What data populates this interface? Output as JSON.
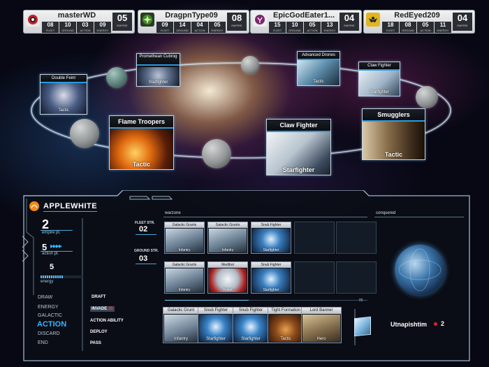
{
  "players": [
    {
      "name": "masterWD",
      "icon": "red-target-emblem",
      "fleet": "08",
      "ground": "10",
      "action": "03",
      "energy": "09",
      "empire": "05",
      "color": "#c8202a"
    },
    {
      "name": "DragpnType09",
      "icon": "green-star-emblem",
      "fleet": "09",
      "ground": "14",
      "action": "04",
      "energy": "05",
      "empire": "08",
      "color": "#3a8a2a"
    },
    {
      "name": "EpicGodEater1...",
      "icon": "purple-symbol-emblem",
      "fleet": "15",
      "ground": "10",
      "action": "05",
      "energy": "13",
      "empire": "04",
      "color": "#7a2a6a"
    },
    {
      "name": "RedEyed209",
      "icon": "yellow-eagle-emblem",
      "fleet": "18",
      "ground": "08",
      "action": "05",
      "energy": "11",
      "empire": "04",
      "color": "#e0b520"
    }
  ],
  "stat_labels": {
    "fleet": "FLEET",
    "ground": "GROUND",
    "action": "ACTION",
    "energy": "ENERGY",
    "empire": "EMPIRE"
  },
  "board_cards": [
    {
      "title": "Double Feint",
      "footer": "Tactic"
    },
    {
      "title": "Promethean Cubrog",
      "footer": "Starfighter"
    },
    {
      "title": "Advanced Drones",
      "footer": "Tactic"
    },
    {
      "title": "Claw Fighter",
      "footer": "Starfighter"
    },
    {
      "title": "Flame Troopers",
      "footer": "Tactic"
    },
    {
      "title": "Claw Fighter",
      "footer": "Starfighter"
    },
    {
      "title": "Smugglers",
      "footer": "Tactic"
    }
  ],
  "hud": {
    "player_name": "APPLEWHITE",
    "empire_value": "2",
    "empire_label": "empire pt.",
    "action_value": "5",
    "action_label": "action pt.",
    "energy_value": "5",
    "energy_label": "energy",
    "energy_fill": 0.55,
    "phases": [
      "DRAW",
      "ENERGY",
      "GALACTIC",
      "ACTION",
      "DISCARD",
      "END"
    ],
    "active_phase": "ACTION",
    "actions": [
      "DRAFT",
      "INVADE",
      "ACTION ABILITY",
      "DEPLOY",
      "PASS"
    ],
    "invade_cost": "35",
    "fleet_label": "FLEET STR.",
    "fleet_value": "02",
    "ground_label": "GROUND STR.",
    "ground_value": "03",
    "warzone_label": "warzone",
    "conquered_label": "conquered",
    "warzone_count": "06",
    "planet_name": "Utnapishtim",
    "planet_value": "2"
  },
  "warzone_cards": [
    {
      "title": "Galactic Grunts",
      "footer": "Infantry"
    },
    {
      "title": "Galactic Grunts",
      "footer": "Infantry"
    },
    {
      "title": "Snub Fighter",
      "footer": "Starfighter"
    },
    {
      "title": "Galactic Grunts",
      "footer": "Infantry"
    },
    {
      "title": "Medibot",
      "footer": "Robot"
    },
    {
      "title": "Snub Fighter",
      "footer": "Starfighter"
    }
  ],
  "hand_cards": [
    {
      "title": "Galactic Grunt",
      "footer": "Infantry"
    },
    {
      "title": "Snub Fighter",
      "footer": "Starfighter"
    },
    {
      "title": "Snub Fighter",
      "footer": "Starfighter"
    },
    {
      "title": "Tight Formation",
      "footer": "Tactic"
    },
    {
      "title": "Lord Banner",
      "footer": "Hero"
    }
  ],
  "colors": {
    "accent": "#2a9ae0",
    "hud_line": "#9fb6c8",
    "active_phase": "#35b5ff",
    "invade_badge": "#e0202a"
  }
}
